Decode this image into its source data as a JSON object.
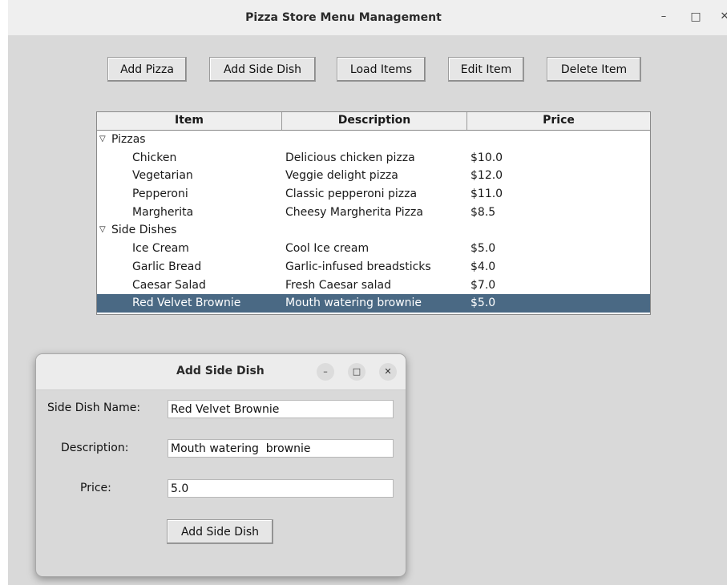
{
  "window": {
    "title": "Pizza Store Menu Management",
    "minimize": "–",
    "maximize": "□",
    "close": "✕"
  },
  "toolbar": {
    "add_pizza": "Add Pizza",
    "add_side_dish": "Add Side Dish",
    "load_items": "Load Items",
    "edit_item": "Edit Item",
    "delete_item": "Delete Item"
  },
  "tree": {
    "columns": [
      "Item",
      "Description",
      "Price"
    ],
    "expand_glyph": "▽",
    "groups": [
      {
        "name": "Pizzas",
        "rows": [
          {
            "item": "Chicken",
            "description": "Delicious chicken pizza",
            "price": "$10.0"
          },
          {
            "item": "Vegetarian",
            "description": "Veggie delight pizza",
            "price": "$12.0"
          },
          {
            "item": "Pepperoni",
            "description": "Classic pepperoni pizza",
            "price": "$11.0"
          },
          {
            "item": "Margherita",
            "description": "Cheesy Margherita Pizza",
            "price": "$8.5"
          }
        ]
      },
      {
        "name": "Side Dishes",
        "rows": [
          {
            "item": "Ice Cream",
            "description": "Cool Ice cream",
            "price": "$5.0"
          },
          {
            "item": "Garlic Bread",
            "description": "Garlic-infused breadsticks",
            "price": "$4.0"
          },
          {
            "item": "Caesar Salad",
            "description": "Fresh Caesar salad",
            "price": "$7.0"
          },
          {
            "item": "Red Velvet Brownie",
            "description": "Mouth watering  brownie",
            "price": "$5.0"
          }
        ]
      }
    ],
    "selected_row": "Red Velvet Brownie"
  },
  "dialog": {
    "title": "Add Side Dish",
    "minimize": "–",
    "maximize": "□",
    "close": "✕",
    "name_label": "Side Dish Name:",
    "name_value": "Red Velvet Brownie",
    "description_label": "Description:",
    "description_value": "Mouth watering  brownie",
    "price_label": "Price:",
    "price_value": "5.0",
    "submit_label": "Add Side Dish"
  },
  "colors": {
    "selection": "#4a6984",
    "background": "#d9d9d9"
  }
}
